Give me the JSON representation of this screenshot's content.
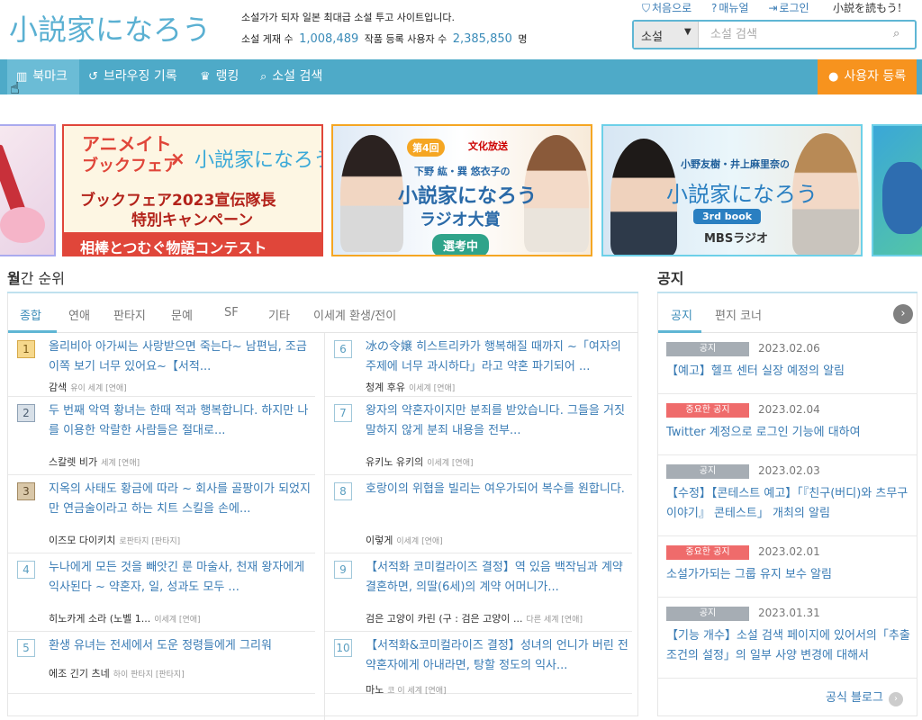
{
  "header": {
    "logo_text": "小説家になろう",
    "tagline": "소설가가 되자 일본 최대급 소설 투고 사이트입니다.",
    "stats": {
      "novels_label": "소설 게재 수",
      "novels_count": "1,008,489",
      "users_label": "작품 등록 사용자 수",
      "users_count": "2,385,850",
      "users_unit": "명"
    },
    "top_links": [
      {
        "icon": "home-icon",
        "label": "처음으로"
      },
      {
        "icon": "help-icon",
        "label": "매뉴얼"
      },
      {
        "icon": "login-icon",
        "label": "로그인"
      }
    ],
    "read_logo": "小説を読もう!",
    "search": {
      "category": "소설",
      "placeholder": "소설 검색"
    }
  },
  "nav": {
    "bookmark": "북마크",
    "history": "브라우징 기록",
    "ranking": "랭킹",
    "search": "소설 검색",
    "register": "사용자 등록"
  },
  "banners": {
    "b1": {
      "line1": "アニメイト",
      "line2": "ブックフェア",
      "cross": "×",
      "narou": "小説家になろう",
      "line3": "ブックフェア2023宣伝隊長",
      "line4": "特別キャンペーン",
      "line5": "相棒とつむぐ物語コンテスト"
    },
    "b2": {
      "tag": "第4回",
      "publisher": "文化放送",
      "hosts": "下野 紘・巽 悠衣子の",
      "narou": "小説家になろう",
      "award": "ラジオ大賞",
      "selecting": "選考中"
    },
    "b3": {
      "hosts": "小野友樹・井上麻里奈の",
      "narou": "小説家になろう",
      "sub": "3rd book",
      "station": "MBSラジオ"
    }
  },
  "ranking": {
    "title_bold": "월",
    "title_rest": "간 순위",
    "tabs": [
      "종합",
      "연애",
      "판타지",
      "문예",
      "SF",
      "기타",
      "이세계 환생/전이"
    ],
    "left": [
      {
        "rank": "1",
        "title": "올리비아 아가씨는 사랑받으면 죽는다~ 남편님, 조금 이쪽 보기 너무 있어요~【서적...",
        "author": "감색",
        "genre": "유이 세계 [연애]"
      },
      {
        "rank": "2",
        "title": "두 번째 악역 황녀는 한때 적과 행복합니다. 하지만 나를 이용한 악랄한 사람들은 절대로...",
        "author": "스칼렛 비가",
        "genre": "세계 [연애]"
      },
      {
        "rank": "3",
        "title": "지옥의 사태도 황금에 따라 ~ 회사를 골팡이가 되었지만 연금술이라고 하는 치트 스킬을 손에...",
        "author": "이즈모 다이키치",
        "genre": "로판타지 [판타지]"
      },
      {
        "rank": "4",
        "title": "누나에게 모든 것을 빼앗긴 룬 마술사, 천재 왕자에게 익사된다 ~ 약혼자, 일, 성과도 모두 ...",
        "author": "히노카게 소라 (노벨 1...",
        "genre": "이세계 [연애]"
      },
      {
        "rank": "5",
        "title": "환생 유녀는 전세에서 도운 정령들에게 그리워",
        "author": "에조 긴기 츠네",
        "genre": "하이 판타지 [판타지]"
      }
    ],
    "right": [
      {
        "rank": "6",
        "title": "冰の令嬢 히스트리카가 행복해질 때까지 ~「여자의 주제에 너무 과시하다」라고 약혼 파기되어 ...",
        "author": "청계 후유",
        "genre": "이세계 [연애]"
      },
      {
        "rank": "7",
        "title": "왕자의 약혼자이지만 분죄를 받았습니다. 그들을 거짓말하지 않게 분죄 내용을 전부...",
        "author": "유키노 유키의",
        "genre": "이세계 [연애]"
      },
      {
        "rank": "8",
        "title": "호랑이의 위협을 빌리는 여우가되어 복수를 원합니다.",
        "author": "이렇게",
        "genre": "이세계 [연애]"
      },
      {
        "rank": "9",
        "title": "【서적화 코미컬라이즈 결정】역 있음 백작님과 계약 결혼하면, 의딸(6세)의 계약 어머니가...",
        "author": "검은 고양이 카린 (구 : 검은 고양이 ...",
        "genre": "다른 세계 [연애]"
      },
      {
        "rank": "10",
        "title": "【서적화&코미컬라이즈 결정】성녀의 언니가 버린 전 약혼자에게 아내라면, 탕할 정도의 익사...",
        "author": "마노",
        "genre": "코 이 세계 [연애]"
      }
    ]
  },
  "notice": {
    "title": "공지",
    "tabs": [
      "공지",
      "편지 코너"
    ],
    "items": [
      {
        "badge": "공지",
        "type": "normal",
        "date": "2023.02.06",
        "title": "【예고】헬프 센터 실장 예정의 알림"
      },
      {
        "badge": "중요한 공지",
        "type": "important",
        "date": "2023.02.04",
        "title": "Twitter 계정으로 로그인 기능에 대하여"
      },
      {
        "badge": "공지",
        "type": "normal",
        "date": "2023.02.03",
        "title": "【수정】【콘테스트 예고】「『친구(버디)와 츠무구 이야기』 콘테스트」 개최의 알림"
      },
      {
        "badge": "중요한 공지",
        "type": "important",
        "date": "2023.02.01",
        "title": "소설가가되는 그룹 유지 보수 알림"
      },
      {
        "badge": "공지",
        "type": "normal",
        "date": "2023.01.31",
        "title": "【기능 개수】소설 검색 페이지에 있어서의「추출 조건의 설정」의 일부 사양 변경에 대해서"
      }
    ],
    "blog_label": "공식 블로그"
  },
  "colors": {
    "nav_bg": "#4eaac8",
    "accent_orange": "#f7931e",
    "link_blue": "#3a7cb5",
    "important_red": "#ef6b6b"
  }
}
